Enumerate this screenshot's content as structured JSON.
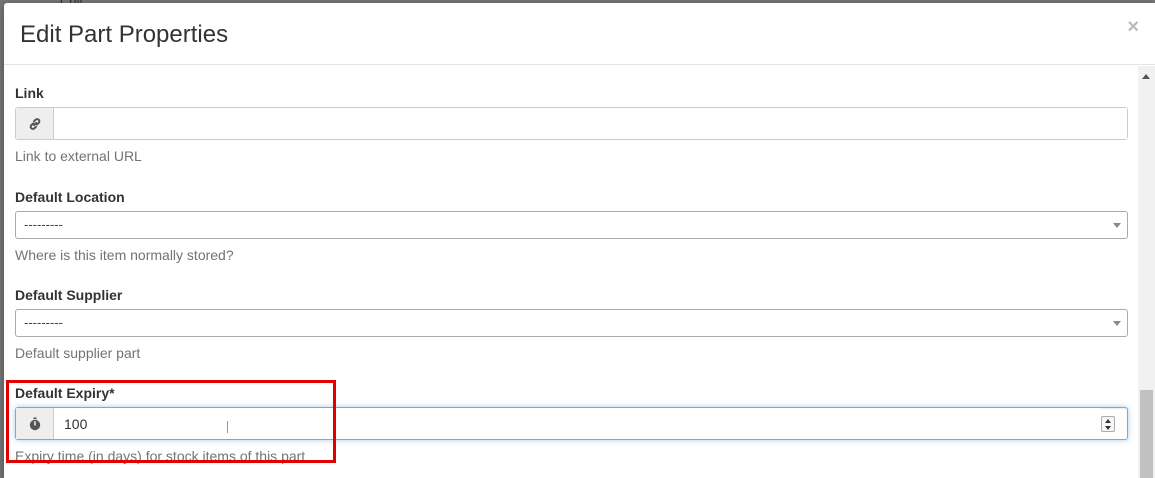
{
  "background": {
    "fragment_text": "Coll"
  },
  "modal": {
    "title": "Edit Part Properties",
    "close_symbol": "×"
  },
  "fields": {
    "link": {
      "label": "Link",
      "icon": "link-icon",
      "value": "",
      "help": "Link to external URL"
    },
    "default_location": {
      "label": "Default Location",
      "selected": "---------",
      "help": "Where is this item normally stored?"
    },
    "default_supplier": {
      "label": "Default Supplier",
      "selected": "---------",
      "help": "Default supplier part"
    },
    "default_expiry": {
      "label": "Default Expiry*",
      "icon": "stopwatch-icon",
      "value": "100",
      "help": "Expiry time (in days) for stock items of this part"
    }
  },
  "colors": {
    "highlight": "#e00000",
    "focus": "#66afe9"
  }
}
